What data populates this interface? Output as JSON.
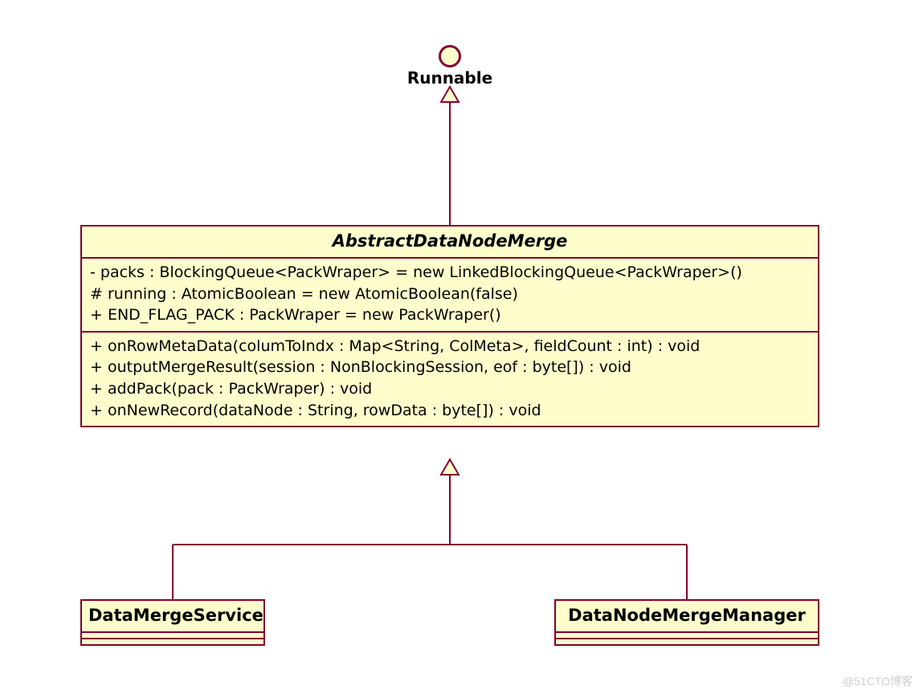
{
  "interface": {
    "name": "Runnable"
  },
  "abstractClass": {
    "name": "AbstractDataNodeMerge",
    "attributes": [
      "- packs : BlockingQueue<PackWraper> = new LinkedBlockingQueue<PackWraper>()",
      "# running : AtomicBoolean = new AtomicBoolean(false)",
      "+ END_FLAG_PACK : PackWraper = new PackWraper()"
    ],
    "operations": [
      "+ onRowMetaData(columToIndx : Map<String, ColMeta>, fieldCount : int) : void",
      "+ outputMergeResult(session : NonBlockingSession, eof : byte[]) : void",
      "+ addPack(pack : PackWraper) : void",
      "+ onNewRecord(dataNode : String, rowData : byte[]) : void"
    ]
  },
  "subclasses": {
    "left": {
      "name": "DataMergeService"
    },
    "right": {
      "name": "DataNodeMergeManager"
    }
  },
  "watermark": "@51CTO博客"
}
